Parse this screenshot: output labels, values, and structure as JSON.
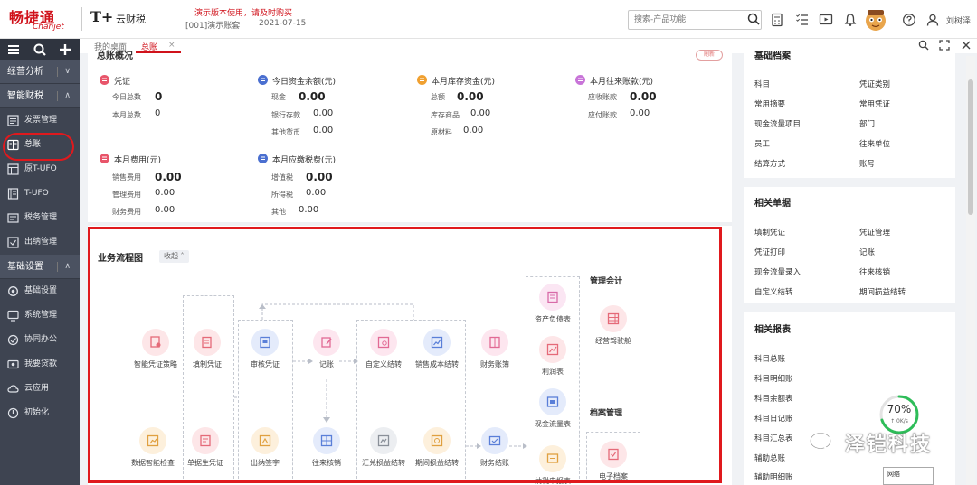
{
  "header": {
    "brand_cn": "畅捷通",
    "brand_en": "Chanjet",
    "product_mark": "T+",
    "product_name": "云财税",
    "demo_warning": "演示版本使用，请及时购买",
    "account_code": "[001]演示账套",
    "account_date": "2021-07-15",
    "search_placeholder": "搜索-产品功能",
    "username": "刘树泽"
  },
  "sidebar": {
    "groups": [
      {
        "label": "经营分析"
      },
      {
        "label": "智能财税"
      },
      {
        "label": "基础设置"
      }
    ],
    "finance_items": [
      {
        "label": "发票管理",
        "icon": "invoice-icon"
      },
      {
        "label": "总账",
        "icon": "ledger-icon"
      },
      {
        "label": "原T-UFO",
        "icon": "ufo-icon"
      },
      {
        "label": "T-UFO",
        "icon": "report-icon"
      },
      {
        "label": "税务管理",
        "icon": "tax-icon"
      },
      {
        "label": "出纳管理",
        "icon": "cashier-icon"
      }
    ],
    "basic_items": [
      {
        "label": "基础设置",
        "icon": "settings-icon"
      },
      {
        "label": "系统管理",
        "icon": "system-icon"
      },
      {
        "label": "协同办公",
        "icon": "collab-icon"
      },
      {
        "label": "我要贷款",
        "icon": "loan-icon"
      },
      {
        "label": "云应用",
        "icon": "cloud-icon"
      },
      {
        "label": "初始化",
        "icon": "init-icon"
      }
    ]
  },
  "tabs": [
    {
      "label": "我的桌面"
    },
    {
      "label": "总账",
      "active": true
    }
  ],
  "overview": {
    "title": "总账概况",
    "refresh": "刷新",
    "cards": [
      {
        "title": "凭证",
        "rows": [
          {
            "label": "今日总数",
            "value": "0"
          },
          {
            "label": "本月总数",
            "value": "0"
          }
        ]
      },
      {
        "title": "今日资金余额(元)",
        "rows": [
          {
            "label": "现金",
            "value": "0.00"
          },
          {
            "label": "银行存款",
            "value": "0.00"
          },
          {
            "label": "其他货币",
            "value": "0.00"
          }
        ]
      },
      {
        "title": "本月库存资金(元)",
        "rows": [
          {
            "label": "总额",
            "value": "0.00"
          },
          {
            "label": "库存商品",
            "value": "0.00"
          },
          {
            "label": "原材料",
            "value": "0.00"
          }
        ]
      },
      {
        "title": "本月往来账款(元)",
        "rows": [
          {
            "label": "应收账款",
            "value": "0.00"
          },
          {
            "label": "应付账款",
            "value": "0.00"
          }
        ]
      },
      {
        "title": "本月费用(元)",
        "rows": [
          {
            "label": "销售费用",
            "value": "0.00"
          },
          {
            "label": "管理费用",
            "value": "0.00"
          },
          {
            "label": "财务费用",
            "value": "0.00"
          }
        ]
      },
      {
        "title": "本月应缴税费(元)",
        "rows": [
          {
            "label": "增值税",
            "value": "0.00"
          },
          {
            "label": "所得税",
            "value": "0.00"
          },
          {
            "label": "其他",
            "value": "0.00"
          }
        ]
      }
    ]
  },
  "flow": {
    "title": "业务流程图",
    "collapse_label": "收起",
    "section_mgmt": "管理会计",
    "section_archive": "档案管理",
    "nodes": [
      {
        "label": "智能凭证策略"
      },
      {
        "label": "填制凭证"
      },
      {
        "label": "审核凭证"
      },
      {
        "label": "记账"
      },
      {
        "label": "自定义结转"
      },
      {
        "label": "销售成本结转"
      },
      {
        "label": "财务账簿"
      },
      {
        "label": "资产负债表"
      },
      {
        "label": "利润表"
      },
      {
        "label": "现金流量表"
      },
      {
        "label": "纳税申报表"
      },
      {
        "label": "经营驾驶舱"
      },
      {
        "label": "数据智能检查"
      },
      {
        "label": "单据生凭证"
      },
      {
        "label": "出纳签字"
      },
      {
        "label": "往来核销"
      },
      {
        "label": "汇兑损益结转"
      },
      {
        "label": "期间损益结转"
      },
      {
        "label": "财务结账"
      },
      {
        "label": "电子档案"
      }
    ]
  },
  "right_panel": {
    "basic_title": "基础档案",
    "basic_links": [
      "科目",
      "凭证类别",
      "常用摘要",
      "常用凭证",
      "现金流量项目",
      "部门",
      "员工",
      "往来单位",
      "结算方式",
      "账号"
    ],
    "docs_title": "相关单据",
    "docs_links": [
      "填制凭证",
      "凭证管理",
      "凭证打印",
      "记账",
      "现金流量录入",
      "往来核销",
      "自定义结转",
      "期间损益结转"
    ],
    "reports_title": "相关报表",
    "reports_links": [
      "科目总账",
      "科目明细账",
      "科目余额表",
      "科目日记账",
      "科目汇总表",
      "辅助总账",
      "辅助明细账"
    ]
  },
  "overlay": {
    "gauge_percent": "70%",
    "gauge_value": 0.7,
    "gauge_speed": "↑ 0K/s",
    "watermark": "泽铠科技",
    "network_label": "网络"
  },
  "colors": {
    "brand_red": "#d0121b",
    "sidebar_bg": "#3e4451",
    "highlight_red": "#e0191d",
    "dot_voucher": "#e8556a",
    "dot_fund": "#4a6fd0",
    "dot_stock": "#f0a030",
    "dot_ar": "#c874d8",
    "gauge_green": "#2ebd59"
  }
}
